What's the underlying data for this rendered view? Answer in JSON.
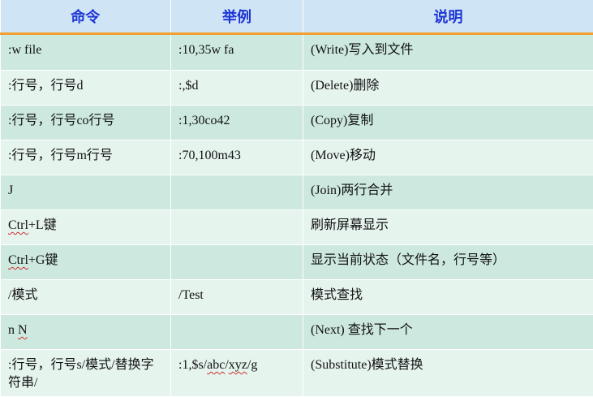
{
  "headers": [
    "命令",
    "举例",
    "说明"
  ],
  "rows": [
    {
      "command": ":w file",
      "example": ":10,35w fa",
      "description": "(Write)写入到文件"
    },
    {
      "command": ":行号，行号d",
      "example": ":,$d",
      "description": "(Delete)删除"
    },
    {
      "command": ":行号，行号co行号",
      "example": ":1,30co42",
      "description": "(Copy)复制"
    },
    {
      "command": ":行号，行号m行号",
      "example": ":70,100m43",
      "description": "(Move)移动"
    },
    {
      "command": "J",
      "example": "",
      "description": "(Join)两行合并"
    },
    {
      "command_pre": "Ctrl",
      "command_post": "+L键",
      "example": "",
      "description": "刷新屏幕显示"
    },
    {
      "command_pre": "Ctrl",
      "command_post": "+G键",
      "example": "",
      "description": "显示当前状态（文件名，行号等）"
    },
    {
      "command": "/模式",
      "example": "/Test",
      "description": "模式查找"
    },
    {
      "command_pre": "n ",
      "command_post": "N",
      "example": "",
      "description": "(Next) 查找下一个"
    },
    {
      "command": ":行号，行号s/模式/替换字符串/",
      "example_pre": ":1,$s/",
      "example_abc": "abc",
      "example_mid": "/",
      "example_xyz": "xyz",
      "example_post": "/g",
      "description": "(Substitute)模式替换"
    }
  ]
}
